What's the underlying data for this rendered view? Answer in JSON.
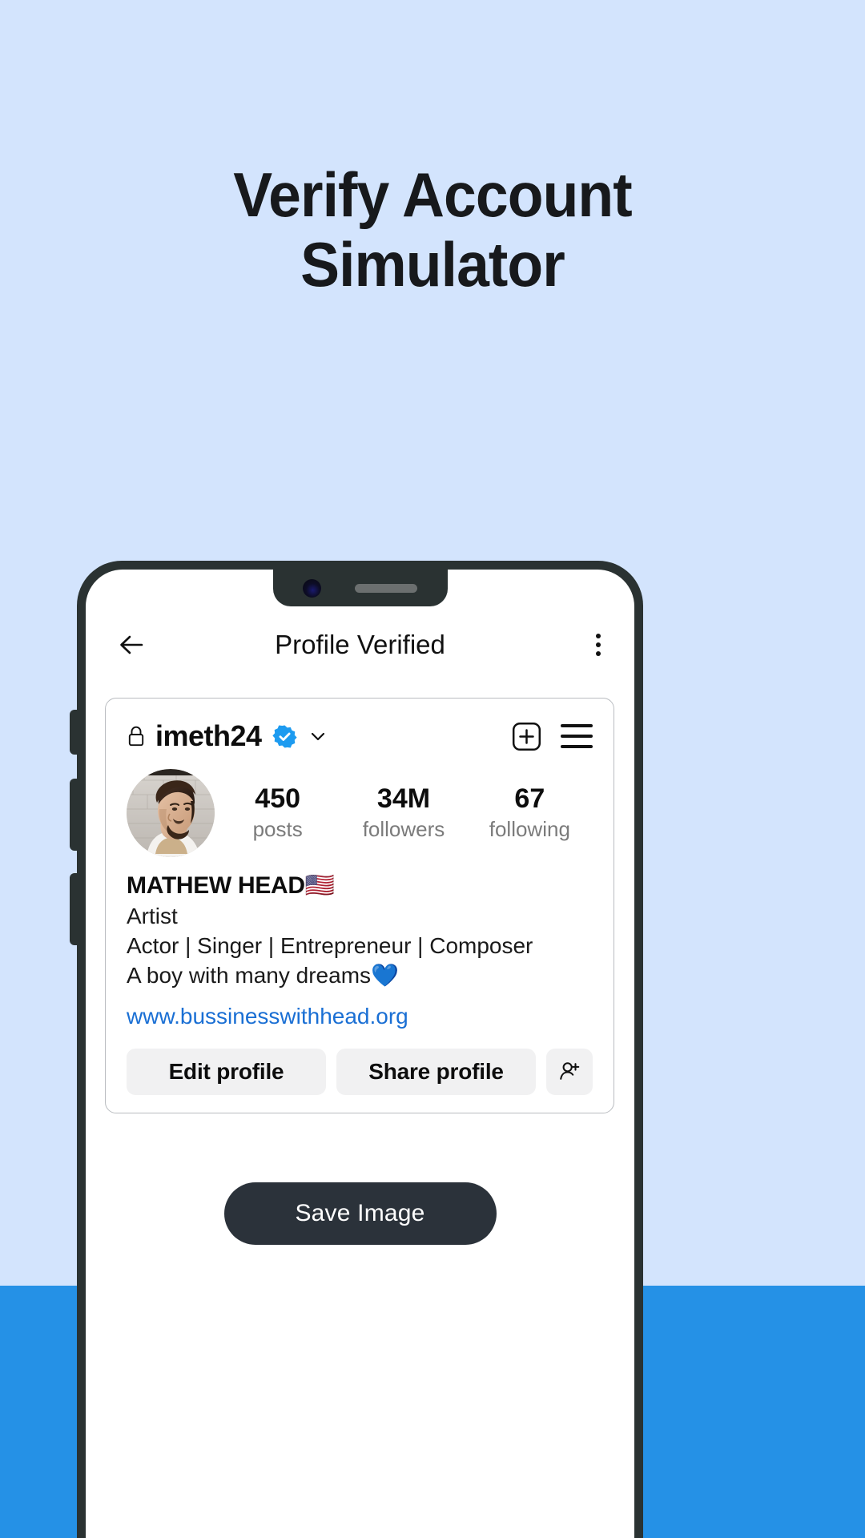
{
  "page": {
    "headline_line1": "Verify Account",
    "headline_line2": "Simulator",
    "background_color": "#d3e4fd",
    "band_color": "#2591e6"
  },
  "phone": {
    "frame_color": "#2a3232",
    "camera": "camera-dot",
    "speaker": "speaker-bar"
  },
  "app_header": {
    "back_icon": "arrow-left-icon",
    "title": "Profile Verified",
    "overflow_icon": "more-vertical-icon"
  },
  "profile": {
    "lock_icon": "lock-icon",
    "username": "imeth24",
    "verified_icon": "verified-badge-icon",
    "verified_color": "#1d9bf0",
    "chevron_icon": "chevron-down-icon",
    "add_post_icon": "plus-box-icon",
    "menu_icon": "hamburger-icon",
    "avatar_alt": "profile-photo",
    "stats": [
      {
        "value": "450",
        "label": "posts"
      },
      {
        "value": "34M",
        "label": "followers"
      },
      {
        "value": "67",
        "label": "following"
      }
    ],
    "display_name": "MATHEW HEAD🇺🇸",
    "bio_lines": [
      "Artist",
      "Actor | Singer | Entrepreneur | Composer",
      "A boy with many dreams💙"
    ],
    "link": "www.bussinesswithhead.org",
    "link_color": "#1a6fd4",
    "actions": {
      "edit_label": "Edit profile",
      "share_label": "Share profile",
      "add_person_icon": "add-person-icon"
    }
  },
  "save": {
    "label": "Save Image",
    "color": "#2b323a"
  }
}
